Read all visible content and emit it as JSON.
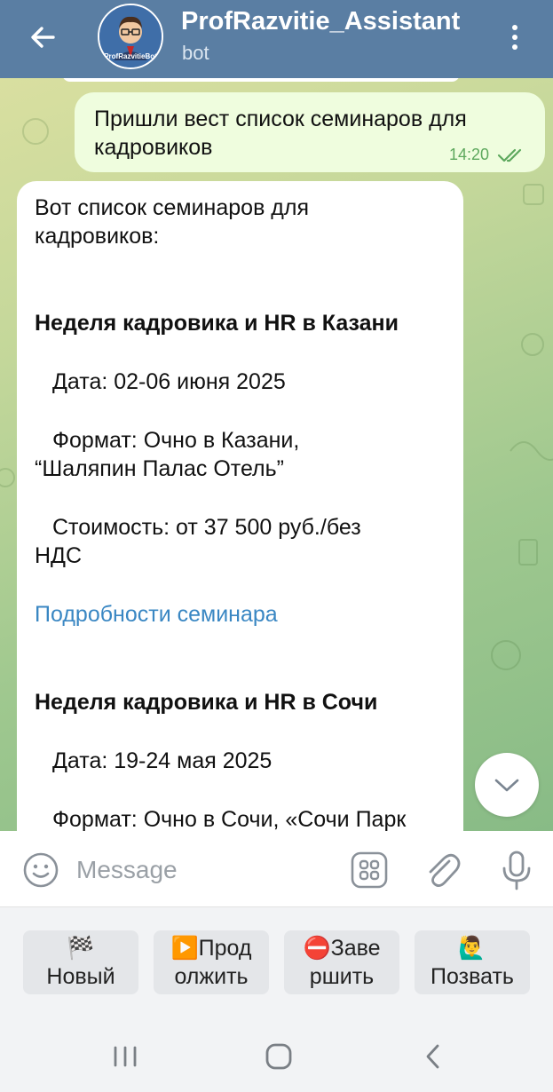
{
  "header": {
    "title": "ProfRazvitie_Assistant",
    "subtitle": "bot",
    "avatar_caption": "ProfRazvitieBot",
    "color": "#5a7ea3"
  },
  "messages": {
    "outgoing": {
      "text": "Пришли вест список семинаров для кадровиков",
      "time": "14:20"
    },
    "incoming": {
      "intro": [
        "Вот список семинаров для",
        "кадровиков:"
      ],
      "seminar1": {
        "title": "Неделя кадровика и HR в Казани",
        "date": "Дата: 02-06 июня 2025",
        "format_line1": "Формат: Очно в Казани,",
        "format_line2": "“Шаляпин Палас Отель”",
        "price_line1": "Стоимость: от 37 500 руб./без",
        "price_line2": "НДС",
        "link": "Подробности семинара"
      },
      "seminar2": {
        "title": "Неделя кадровика и HR в Сочи",
        "date": "Дата: 19-24 мая 2025",
        "format_line1": "Формат: Очно в Сочи, «Сочи Парк"
      }
    }
  },
  "input": {
    "placeholder": "Message"
  },
  "keyboard": {
    "buttons": [
      {
        "emoji": "🏁",
        "line1": "",
        "line2": "Новый"
      },
      {
        "emoji": "▶️",
        "line1": "Прод",
        "line2": "олжить"
      },
      {
        "emoji": "⛔",
        "line1": "Заве",
        "line2": "ршить"
      },
      {
        "emoji": "🙋‍♂️",
        "line1": "",
        "line2": "Позвать"
      }
    ]
  },
  "colors": {
    "accent": "#5a7ea3",
    "link": "#3a87c3",
    "outgoing_bubble": "#effdde",
    "check": "#5da85d"
  }
}
